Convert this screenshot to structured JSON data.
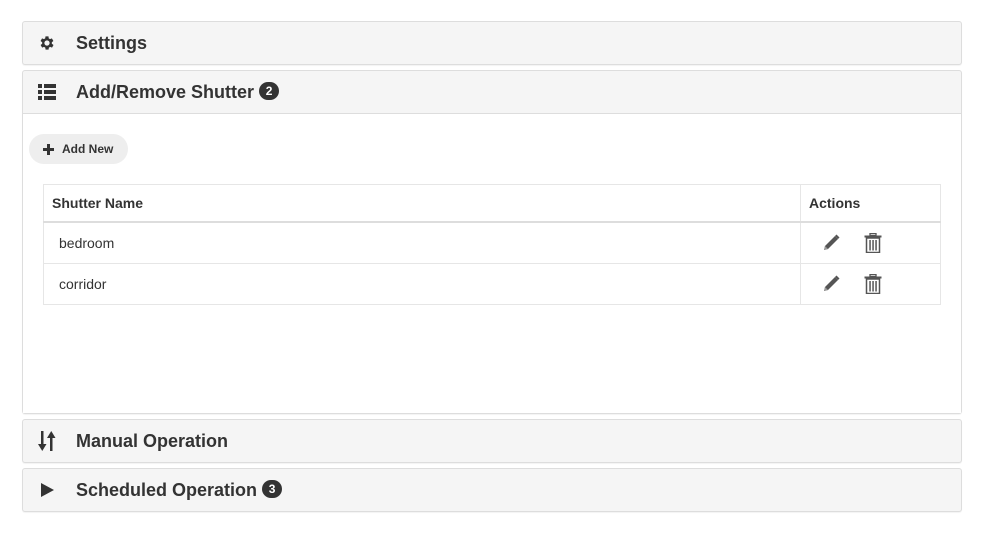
{
  "panels": [
    {
      "title": "Settings",
      "icon": "gear-icon"
    },
    {
      "title": "Add/Remove Shutter",
      "badge": "2",
      "icon": "list-icon",
      "add_button_label": "Add New",
      "table": {
        "headers": [
          "Shutter Name",
          "Actions"
        ],
        "rows": [
          {
            "name": "bedroom"
          },
          {
            "name": "corridor"
          }
        ]
      }
    },
    {
      "title": "Manual Operation",
      "icon": "sort-arrows-icon"
    },
    {
      "title": "Scheduled Operation",
      "badge": "3",
      "icon": "play-icon"
    }
  ],
  "colors": {
    "panel_bg": "#f5f5f5",
    "border": "#dddddd",
    "text": "#333333",
    "badge_bg": "#333333",
    "button_bg": "#eeeeee"
  }
}
